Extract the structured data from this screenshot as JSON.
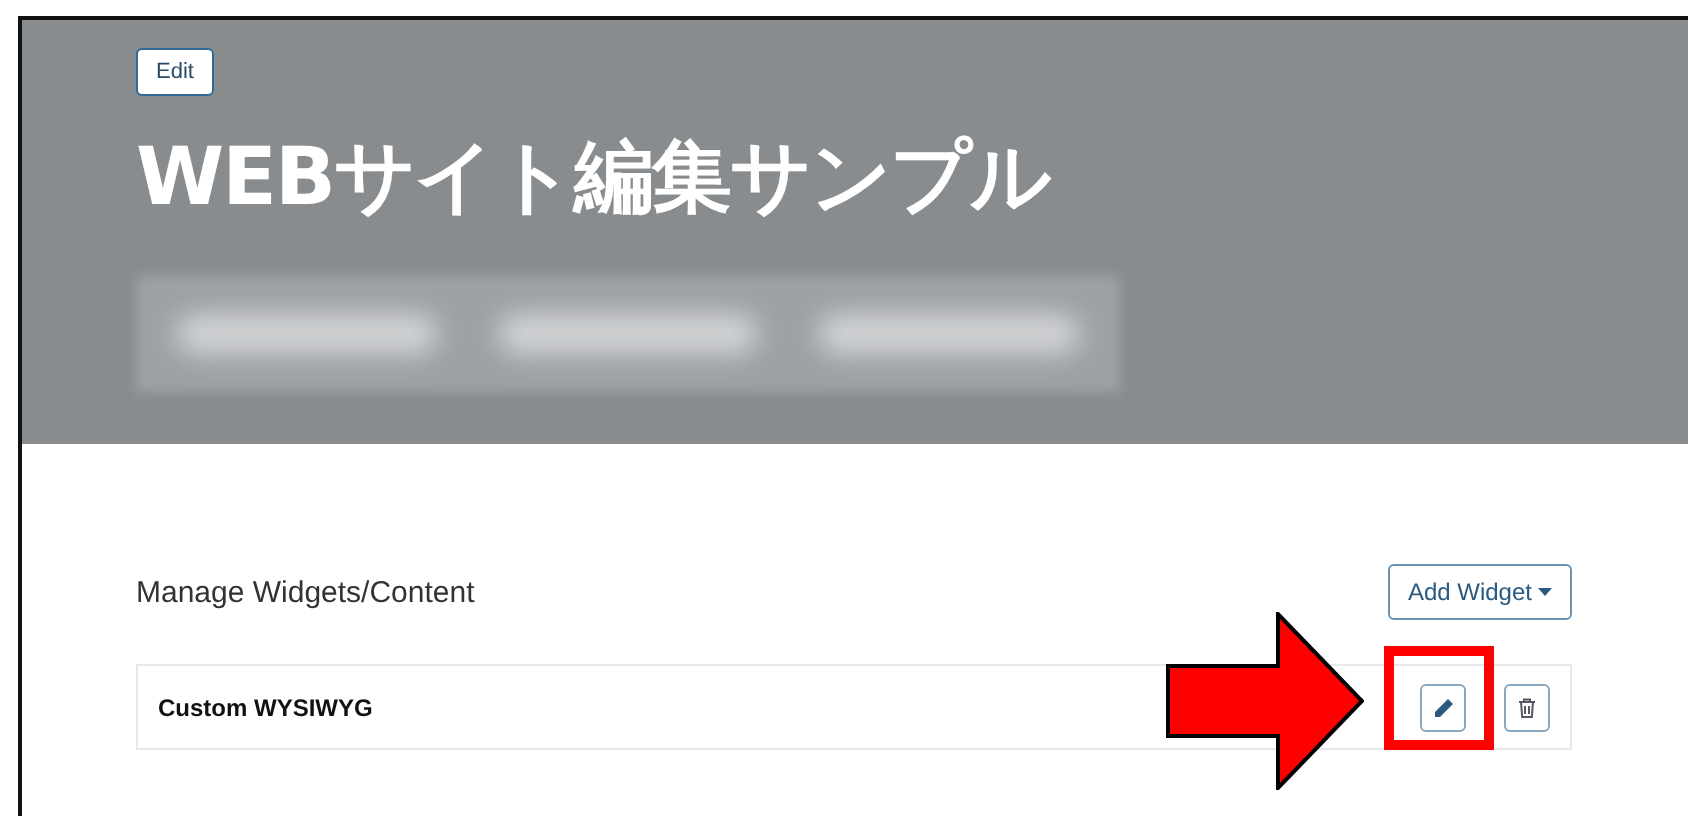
{
  "hero": {
    "edit_button": "Edit",
    "title": "WEBサイト編集サンプル"
  },
  "widgets_section": {
    "heading": "Manage Widgets/Content",
    "add_button": "Add Widget",
    "widgets": [
      {
        "name": "Custom WYSIWYG",
        "edit_highlighted": true
      }
    ]
  }
}
